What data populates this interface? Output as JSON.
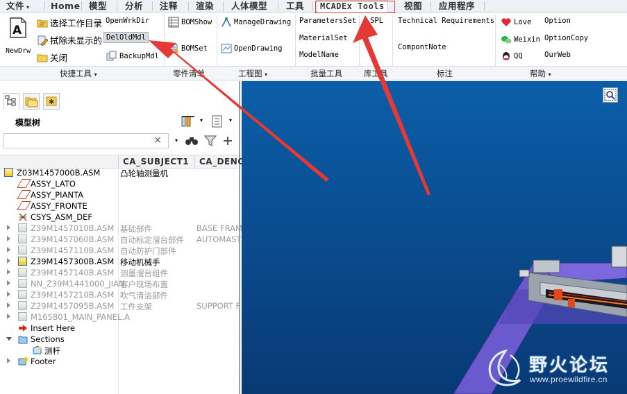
{
  "tabs": [
    {
      "label": "文件",
      "has_dropdown": true
    },
    {
      "label": "Home"
    },
    {
      "label": "模型"
    },
    {
      "label": "分析"
    },
    {
      "label": "注释"
    },
    {
      "label": "渲染"
    },
    {
      "label": "人体模型"
    },
    {
      "label": "工具"
    },
    {
      "label": "MCADEx Tools",
      "active": true
    },
    {
      "label": "视图"
    },
    {
      "label": "应用程序"
    }
  ],
  "ribbon": {
    "newdrw": "NewDrw",
    "select_workdir": "选择工作目录",
    "erase_not_displayed": "拭除未显示的",
    "close": "关闭",
    "open_wrkdir": "OpenWrkDir",
    "del_old_mdl": "DelOldMdl",
    "backup_mdl": "BackupMdl",
    "bom_show": "BOMShow",
    "bom_set": "BOMSet",
    "manage_drawing": "ManageDrawing",
    "open_drawing": "OpenDrawing",
    "parameters_set": "ParametersSet",
    "material_set": "MaterialSet",
    "model_name": "ModelName",
    "spl": "SPL",
    "technical_requirements": "Technical Requirements",
    "compont_note": "CompontNote",
    "love": "Love",
    "weixin": "Weixin",
    "qq": "QQ",
    "option": "Option",
    "option_copy": "OptionCopy",
    "our_web": "OurWeb"
  },
  "groups": {
    "quick_tools": "快捷工具",
    "parts_list": "零件清单",
    "drawing": "工程图",
    "batch_tools": "批量工具",
    "library_tools": "库工具",
    "annotation": "标注",
    "help": "帮助"
  },
  "model_tree": {
    "title": "模型树",
    "search_value": "",
    "columns": [
      "CA_SUBJECT1",
      "CA_DENO"
    ],
    "rows": [
      {
        "name": "Z03M1457000B.ASM",
        "subject": "凸轮轴测量机",
        "deno": "",
        "type": "asm",
        "expander": "none",
        "indent": 0,
        "dim": false
      },
      {
        "name": "ASSY_LATO",
        "subject": "",
        "deno": "",
        "type": "plane",
        "expander": "none",
        "indent": 1,
        "dim": false
      },
      {
        "name": "ASSY_PIANTA",
        "subject": "",
        "deno": "",
        "type": "plane",
        "expander": "none",
        "indent": 1,
        "dim": false
      },
      {
        "name": "ASSY_FRONTE",
        "subject": "",
        "deno": "",
        "type": "plane",
        "expander": "none",
        "indent": 1,
        "dim": false
      },
      {
        "name": "CSYS_ASM_DEF",
        "subject": "",
        "deno": "",
        "type": "csys",
        "expander": "none",
        "indent": 1,
        "dim": false
      },
      {
        "name": "Z39M1457010B.ASM",
        "subject": "基础部件",
        "deno": "BASE FRAM",
        "type": "asm",
        "expander": "closed",
        "indent": 1,
        "dim": true
      },
      {
        "name": "Z39M1457060B.ASM",
        "subject": "自动标定溜台部件",
        "deno": "AUTOMAST",
        "type": "asm",
        "expander": "closed",
        "indent": 1,
        "dim": true
      },
      {
        "name": "Z39M1457110B.ASM",
        "subject": "自动防护门部件",
        "deno": "",
        "type": "asm",
        "expander": "closed",
        "indent": 1,
        "dim": true
      },
      {
        "name": "Z39M1457300B.ASM",
        "subject": "移动机械手",
        "deno": "",
        "type": "asm",
        "expander": "closed",
        "indent": 1,
        "dim": false
      },
      {
        "name": "Z39M1457140B.ASM",
        "subject": "测量溜台组件",
        "deno": "",
        "type": "asm",
        "expander": "closed",
        "indent": 1,
        "dim": true
      },
      {
        "name": "NN_Z39M1441000_JIAN",
        "subject": "客户现场布置",
        "deno": "",
        "type": "asm",
        "expander": "closed",
        "indent": 1,
        "dim": true
      },
      {
        "name": "Z39M1457210B.ASM",
        "subject": "吹气清洁部件",
        "deno": "",
        "type": "asm",
        "expander": "closed",
        "indent": 1,
        "dim": true
      },
      {
        "name": "Z29M1457095B.ASM",
        "subject": "工件支架",
        "deno": "SUPPORT F",
        "type": "asm",
        "expander": "closed",
        "indent": 1,
        "dim": true
      },
      {
        "name": "M165801_MAIN_PANEL.A",
        "subject": "",
        "deno": "",
        "type": "asm",
        "expander": "closed",
        "indent": 1,
        "dim": true
      },
      {
        "name": "Insert Here",
        "subject": "",
        "deno": "",
        "type": "insert",
        "expander": "none",
        "indent": 1,
        "dim": false
      },
      {
        "name": "Sections",
        "subject": "",
        "deno": "",
        "type": "sections",
        "expander": "open",
        "indent": 1,
        "dim": false
      },
      {
        "name": "测杆",
        "subject": "",
        "deno": "",
        "type": "section",
        "expander": "none",
        "indent": 2,
        "dim": false
      },
      {
        "name": "Footer",
        "subject": "",
        "deno": "",
        "type": "footer",
        "expander": "closed",
        "indent": 1,
        "dim": false
      }
    ]
  },
  "watermark": {
    "title": "野火论坛",
    "url": "www.proewildfire.cn"
  },
  "colors": {
    "annotation_red": "#e53935",
    "viewport_top": "#0b5fa8",
    "viewport_bottom": "#083a75",
    "machine_purple": "#6a5acd"
  },
  "icons": [
    "new-drawing-icon",
    "select-workdir-icon",
    "erase-icon",
    "close-folder-icon",
    "backup-icon",
    "bom-show-icon",
    "bom-set-icon",
    "manage-drawing-icon",
    "open-drawing-icon",
    "love-heart-icon",
    "weixin-icon",
    "qq-icon",
    "refit-zoom-icon",
    "show-tool-icon",
    "settings-icon",
    "filter-icon",
    "add-column-icon"
  ]
}
